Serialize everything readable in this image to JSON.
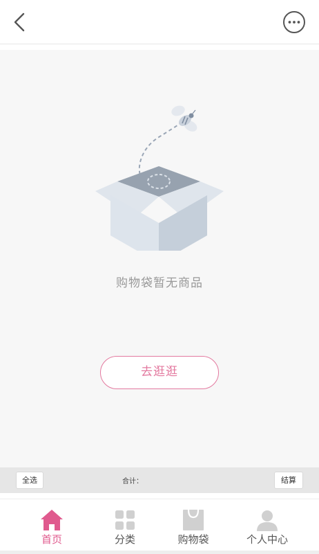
{
  "header": {
    "back_icon": "chevron-left-icon",
    "more_icon": "more-circle-icon"
  },
  "empty_state": {
    "illustration": "open-box-with-bee",
    "message": "购物袋暂无商品",
    "cta_label": "去逛逛"
  },
  "cart_bar": {
    "select_all_label": "全选",
    "total_label": "合计：",
    "checkout_label": "结算"
  },
  "tabbar": {
    "items": [
      {
        "label": "首页",
        "icon": "home-icon",
        "active": true
      },
      {
        "label": "分类",
        "icon": "grid-icon",
        "active": false
      },
      {
        "label": "购物袋",
        "icon": "bag-icon",
        "active": false
      },
      {
        "label": "个人中心",
        "icon": "user-icon",
        "active": false
      }
    ]
  },
  "colors": {
    "accent": "#e3799f",
    "active_tab": "#e05a8e",
    "inactive_icon": "#d0d0d0",
    "text_muted": "#999999",
    "background": "#f7f7f7"
  }
}
